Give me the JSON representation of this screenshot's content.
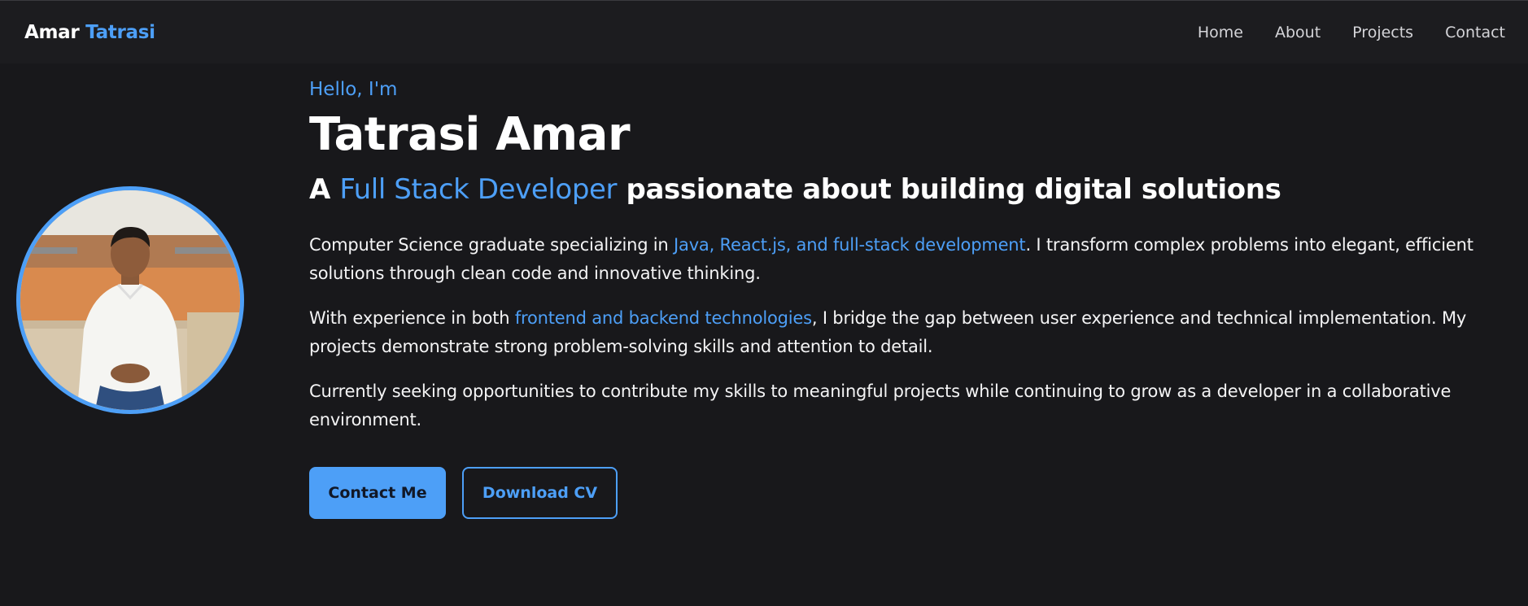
{
  "nav": {
    "brand_first": "Amar",
    "brand_last": "Tatrasi",
    "links": [
      "Home",
      "About",
      "Projects",
      "Contact"
    ]
  },
  "hero": {
    "greeting": "Hello, I'm",
    "name": "Tatrasi Amar",
    "tagline_prefix": "A ",
    "tagline_accent": "Full Stack Developer",
    "tagline_suffix": " passionate about building digital solutions",
    "para1_prefix": "Computer Science graduate specializing in ",
    "para1_highlight": "Java, React.js, and full-stack development",
    "para1_suffix": ". I transform complex problems into elegant, efficient solutions through clean code and innovative thinking.",
    "para2_prefix": "With experience in both ",
    "para2_highlight": "frontend and backend technologies",
    "para2_suffix": ", I bridge the gap between user experience and technical implementation. My projects demonstrate strong problem-solving skills and attention to detail.",
    "para3": "Currently seeking opportunities to contribute my skills to meaningful projects while continuing to grow as a developer in a collaborative environment.",
    "contact_button": "Contact Me",
    "cv_button": "Download CV"
  },
  "colors": {
    "background": "#18181b",
    "navbar": "#1c1c1f",
    "accent": "#4d9ff7",
    "text": "#ffffff"
  },
  "icons": {
    "avatar": "profile-photo"
  }
}
